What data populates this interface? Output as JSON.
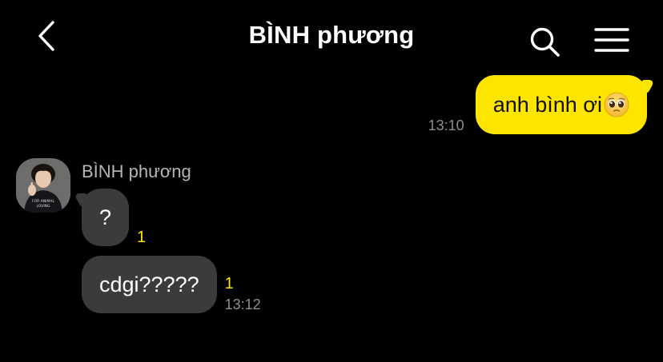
{
  "header": {
    "title": "BÌNH phương"
  },
  "icons": {
    "back": "chevron-left-icon",
    "search": "search-icon",
    "menu": "hamburger-menu-icon",
    "emoji": "pleading-face-emoji"
  },
  "colors": {
    "background": "#000000",
    "outgoing_bubble": "#FEE500",
    "incoming_bubble": "#3B3B3D",
    "unread_count": "#FEE500",
    "timestamp": "#8E8E93"
  },
  "messages": [
    {
      "direction": "outgoing",
      "text": "anh bình ơi",
      "emoji": "🥺",
      "time": "13:10"
    },
    {
      "direction": "incoming",
      "sender": "BÌNH phương",
      "text": "?",
      "unread": "1",
      "time": ""
    },
    {
      "direction": "incoming",
      "sender": "BÌNH phương",
      "text": "cdgi?????",
      "unread": "1",
      "time": "13:12"
    }
  ],
  "avatar": {
    "shirt_text": "FOR ANIMAL LOVING"
  }
}
